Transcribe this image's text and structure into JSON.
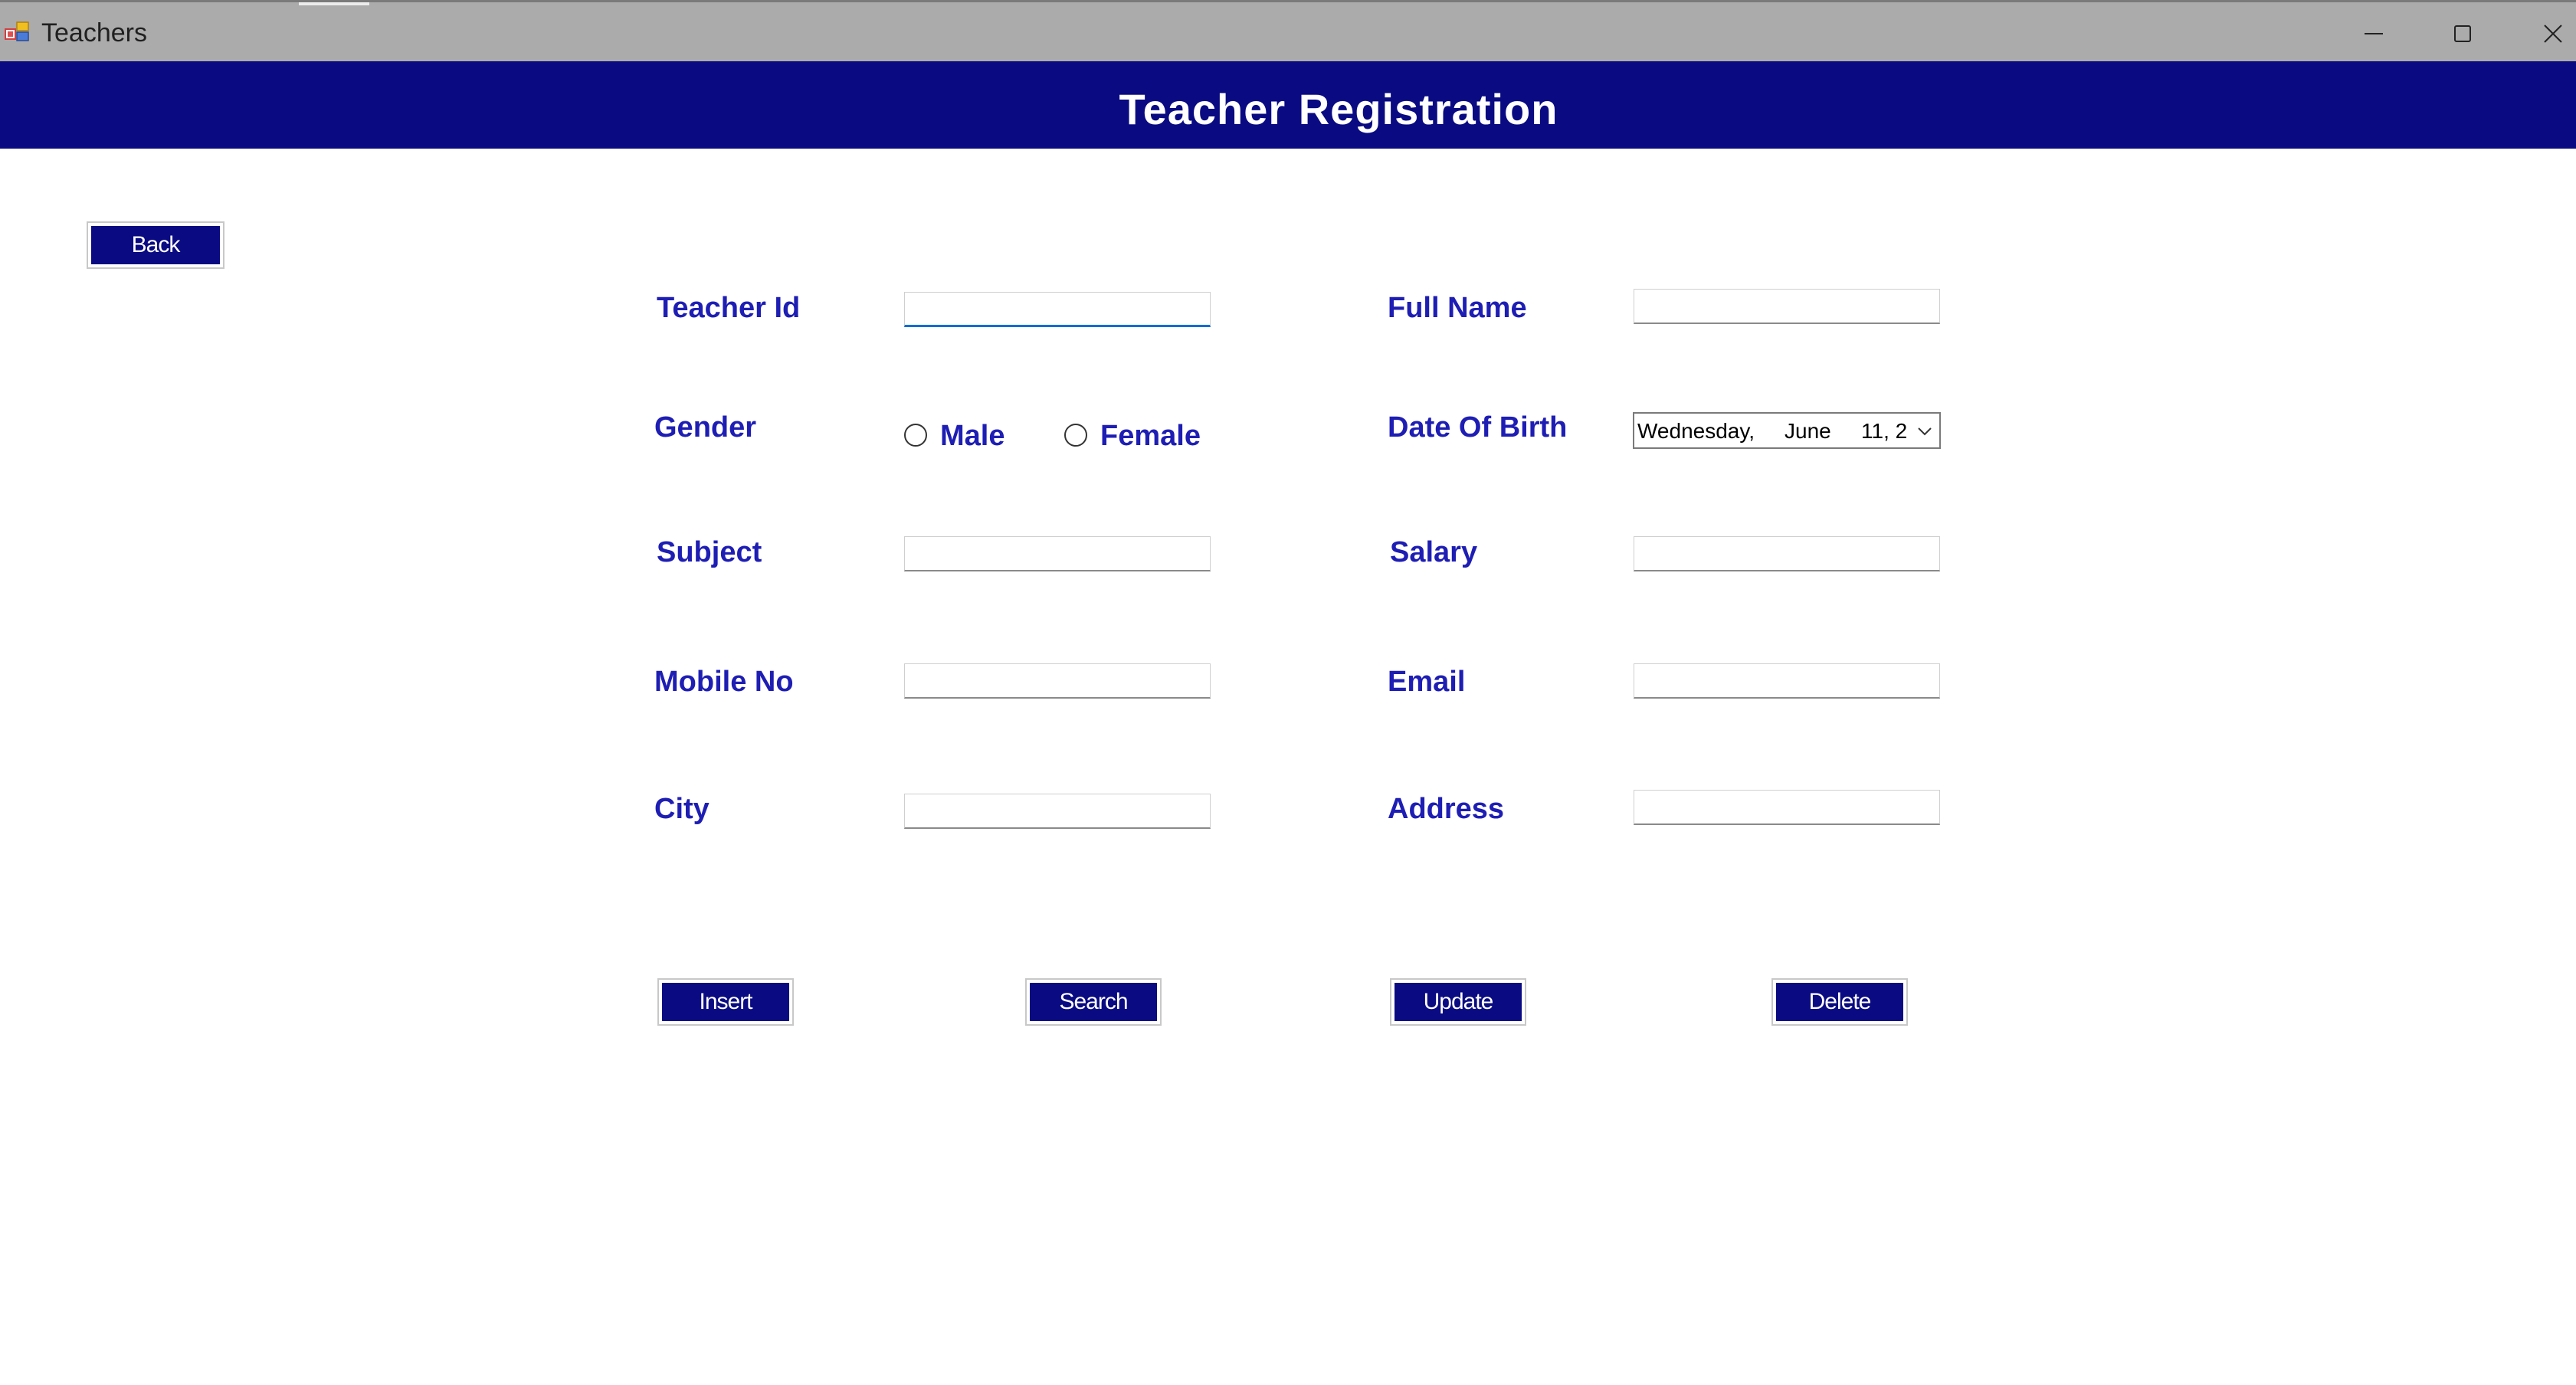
{
  "window": {
    "title": "Teachers",
    "icon": "app-form-icon",
    "controls": [
      "minimize-icon",
      "maximize-icon",
      "close-icon"
    ]
  },
  "header": {
    "title": "Teacher Registration",
    "background": "#0a0a82"
  },
  "nav": {
    "back_label": "Back"
  },
  "form": {
    "teacher_id": {
      "label": "Teacher Id",
      "value": ""
    },
    "full_name": {
      "label": "Full Name",
      "value": ""
    },
    "gender": {
      "label": "Gender",
      "options": [
        "Male",
        "Female"
      ],
      "selected": null
    },
    "dob": {
      "label": "Date Of Birth",
      "day": "Wednesday,",
      "month": "June",
      "date": "11, 2"
    },
    "subject": {
      "label": "Subject",
      "value": ""
    },
    "salary": {
      "label": "Salary",
      "value": ""
    },
    "mobile": {
      "label": "Mobile No",
      "value": ""
    },
    "email": {
      "label": "Email",
      "value": ""
    },
    "city": {
      "label": "City",
      "value": ""
    },
    "address": {
      "label": "Address",
      "value": ""
    }
  },
  "actions": {
    "insert": "Insert",
    "search": "Search",
    "update": "Update",
    "delete": "Delete"
  },
  "colors": {
    "accent": "#0a0a82",
    "label": "#1e1eb4",
    "titlebar": "#ababab"
  }
}
